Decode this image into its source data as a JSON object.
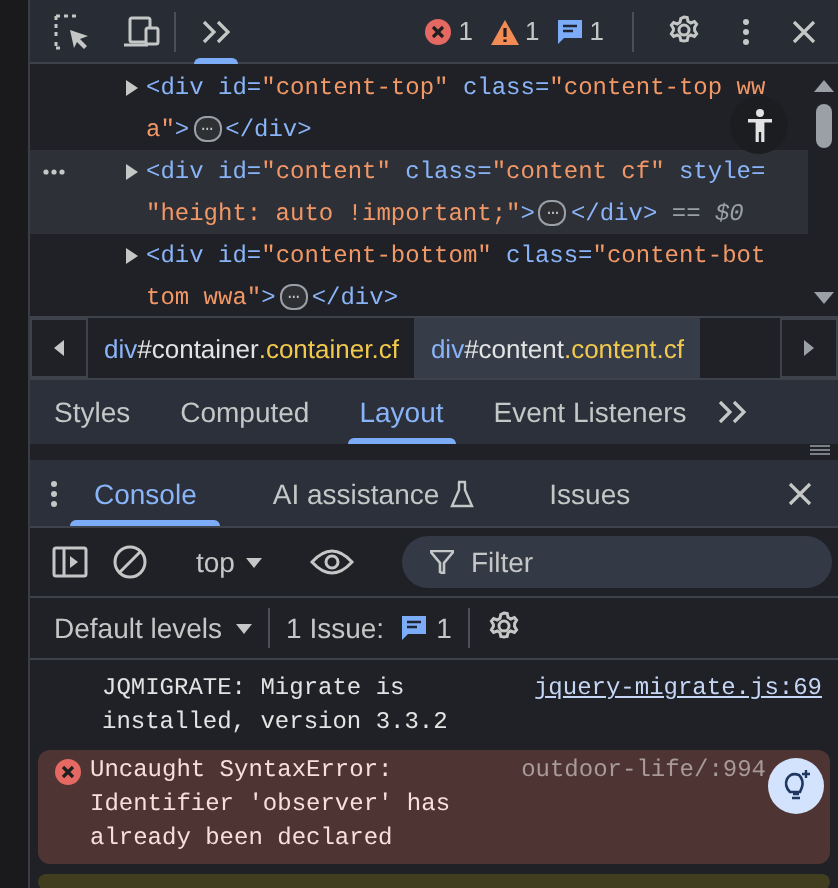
{
  "toolbar": {
    "counts": [
      {
        "kind": "error",
        "count": "1"
      },
      {
        "kind": "warning",
        "count": "1"
      },
      {
        "kind": "info",
        "count": "1"
      }
    ]
  },
  "elements_tree": {
    "nodes": [
      {
        "selected": false,
        "lines": [
          [
            {
              "kind": "tag",
              "text": "<div"
            },
            {
              "kind": "attr",
              "text": " id="
            },
            {
              "kind": "value",
              "text": "\"content-top\""
            },
            {
              "kind": "attr",
              "text": " class="
            },
            {
              "kind": "value",
              "text": "\"content-top ww"
            }
          ],
          [
            {
              "kind": "value",
              "text": "a\""
            },
            {
              "kind": "tag",
              "text": ">"
            },
            {
              "kind": "ellipsis",
              "text": "…"
            },
            {
              "kind": "tag",
              "text": "</div>"
            }
          ]
        ]
      },
      {
        "selected": true,
        "lines": [
          [
            {
              "kind": "tag",
              "text": "<div"
            },
            {
              "kind": "attr",
              "text": " id="
            },
            {
              "kind": "value",
              "text": "\"content\""
            },
            {
              "kind": "attr",
              "text": " class="
            },
            {
              "kind": "value",
              "text": "\"content cf\""
            },
            {
              "kind": "attr",
              "text": " style="
            }
          ],
          [
            {
              "kind": "value",
              "text": "\"height: auto !important;\""
            },
            {
              "kind": "tag",
              "text": ">"
            },
            {
              "kind": "ellipsis",
              "text": "…"
            },
            {
              "kind": "tag",
              "text": "</div>"
            },
            {
              "kind": "marker",
              "text": " == $0"
            }
          ]
        ]
      },
      {
        "selected": false,
        "lines": [
          [
            {
              "kind": "tag",
              "text": "<div"
            },
            {
              "kind": "attr",
              "text": " id="
            },
            {
              "kind": "value",
              "text": "\"content-bottom\""
            },
            {
              "kind": "attr",
              "text": " class="
            },
            {
              "kind": "value",
              "text": "\"content-bot"
            }
          ],
          [
            {
              "kind": "value",
              "text": "tom wwa\""
            },
            {
              "kind": "tag",
              "text": ">"
            },
            {
              "kind": "ellipsis",
              "text": "…"
            },
            {
              "kind": "tag",
              "text": "</div>"
            }
          ]
        ]
      }
    ]
  },
  "breadcrumbs": [
    {
      "tag": "div",
      "id": "#container",
      "classes": ".container.cf",
      "selected": false
    },
    {
      "tag": "div",
      "id": "#content",
      "classes": ".content.cf",
      "selected": true
    }
  ],
  "sidebar_tabs": [
    {
      "label": "Styles",
      "selected": false
    },
    {
      "label": "Computed",
      "selected": false
    },
    {
      "label": "Layout",
      "selected": true
    },
    {
      "label": "Event Listeners",
      "selected": false
    }
  ],
  "drawer_tabs": [
    {
      "label": "Console",
      "selected": true,
      "kind": "plain"
    },
    {
      "label": "AI assistance",
      "selected": false,
      "kind": "experiment"
    },
    {
      "label": "Issues",
      "selected": false,
      "kind": "plain"
    }
  ],
  "console_toolbar": {
    "context": "top",
    "filter": {
      "placeholder": "Filter"
    }
  },
  "levels_bar": {
    "levels": "Default levels",
    "issues_label": "1 Issue:",
    "issues_count": "1"
  },
  "messages": [
    {
      "kind": "log",
      "text": "JQMIGRATE: Migrate is installed, version 3.3.2",
      "source": "jquery-migrate.js:69"
    },
    {
      "kind": "error",
      "text": "Uncaught SyntaxError: Identifier 'observer' has already been declared",
      "source": "outdoor-life/:994"
    },
    {
      "kind": "warning"
    }
  ]
}
